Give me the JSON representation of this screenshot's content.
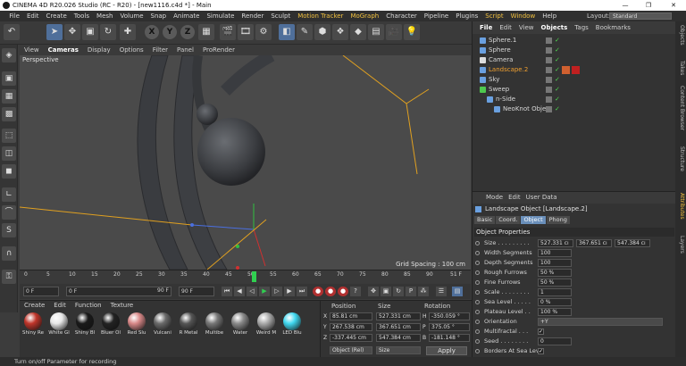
{
  "window": {
    "title": "CINEMA 4D R20.026 Studio (RC - R20) - [new1116.c4d *] - Main",
    "minimize": "—",
    "maximize": "❐",
    "close": "✕"
  },
  "menubar": {
    "items": [
      "File",
      "Edit",
      "Create",
      "Tools",
      "Mesh",
      "Volume",
      "Snap",
      "Animate",
      "Simulate",
      "Render",
      "Sculpt",
      "Motion Tracker",
      "MoGraph",
      "Character",
      "Pipeline",
      "Plugins",
      "Script",
      "Window",
      "Help"
    ],
    "layout_label": "Layout:",
    "layout_value": "Standard"
  },
  "toolbar": {
    "x": "X",
    "y": "Y",
    "z": "Z"
  },
  "viewport": {
    "menu": [
      "View",
      "Cameras",
      "Display",
      "Options",
      "Filter",
      "Panel",
      "ProRender"
    ],
    "label": "Perspective",
    "grid_spacing": "Grid Spacing : 100 cm"
  },
  "timeline": {
    "ticks": [
      "0",
      "5",
      "10",
      "15",
      "20",
      "25",
      "30",
      "35",
      "40",
      "45",
      "50",
      "55",
      "60",
      "65",
      "70",
      "75",
      "80",
      "85",
      "90"
    ],
    "end_label": "51 F",
    "current_frame": 51,
    "frame_field_1": "0 F",
    "frame_field_2": "0 F",
    "frame_field_3": "90 F",
    "frame_field_4": "90 F"
  },
  "materials": {
    "menu": [
      "Create",
      "Edit",
      "Function",
      "Texture"
    ],
    "items": [
      {
        "label": "Shiny Re",
        "color": "#c0352a"
      },
      {
        "label": "White Gl",
        "color": "#e8e8e8"
      },
      {
        "label": "Shiny Bl",
        "color": "#1a1a1a"
      },
      {
        "label": "Bluer Ol",
        "color": "#222222"
      },
      {
        "label": "Red Slu",
        "color": "#d88888"
      },
      {
        "label": "Vulcani",
        "color": "#6a6a6a"
      },
      {
        "label": "R Metal",
        "color": "#555555"
      },
      {
        "label": "Multibe",
        "color": "#777777"
      },
      {
        "label": "Water",
        "color": "#8a8a8a"
      },
      {
        "label": "Weird M",
        "color": "#aaaaaa"
      },
      {
        "label": "LED Blu",
        "color": "#40d8f0"
      }
    ]
  },
  "coords": {
    "headers": [
      "Position",
      "Size",
      "Rotation"
    ],
    "rows": [
      {
        "axis": "X",
        "pos": "85.81 cm",
        "size": "527.331 cm",
        "rot_axis": "H",
        "rot": "-350.059 °"
      },
      {
        "axis": "Y",
        "pos": "267.538 cm",
        "size": "367.651 cm",
        "rot_axis": "P",
        "rot": "375.05 °"
      },
      {
        "axis": "Z",
        "pos": "-337.445 cm",
        "size": "547.384 cm",
        "rot_axis": "B",
        "rot": "-181.148 °"
      }
    ],
    "mode": "Object (Rel)",
    "size_mode": "Size",
    "apply": "Apply"
  },
  "objects": {
    "menu": [
      "File",
      "Edit",
      "View",
      "Objects",
      "Tags",
      "Bookmarks"
    ],
    "list": [
      {
        "name": "Sphere.1",
        "indent": 0,
        "icon": "#6aa0e0",
        "highlight": false
      },
      {
        "name": "Sphere",
        "indent": 0,
        "icon": "#6aa0e0",
        "highlight": false
      },
      {
        "name": "Camera",
        "indent": 0,
        "icon": "#dddddd",
        "highlight": false
      },
      {
        "name": "Landscape.2",
        "indent": 0,
        "icon": "#6aa0e0",
        "highlight": true
      },
      {
        "name": "Sky",
        "indent": 0,
        "icon": "#6aa0e0",
        "highlight": false
      },
      {
        "name": "Sweep",
        "indent": 0,
        "icon": "#4ec84e",
        "highlight": false
      },
      {
        "name": "n-Side",
        "indent": 1,
        "icon": "#6aa0e0",
        "highlight": false
      },
      {
        "name": "NeoKnot Object",
        "indent": 2,
        "icon": "#6aa0e0",
        "highlight": false
      }
    ]
  },
  "sidetabs": [
    "Objects",
    "Takes",
    "Content Browser",
    "Structure",
    "Attributes",
    "Layers"
  ],
  "attributes": {
    "menu": [
      "Mode",
      "Edit",
      "User Data"
    ],
    "title": "Landscape Object [Landscape.2]",
    "tabs": [
      "Basic",
      "Coord.",
      "Object",
      "Phong"
    ],
    "section": "Object Properties",
    "props": [
      {
        "label": "Size . . . . . . . . .",
        "value": "527.331 cı",
        "value2": "367.651 cı",
        "value3": "547.384 cı"
      },
      {
        "label": "Width Segments",
        "value": "100"
      },
      {
        "label": "Depth Segments",
        "value": "100"
      },
      {
        "label": "Rough Furrows",
        "value": "50 %"
      },
      {
        "label": "Fine Furrows",
        "value": "50 %"
      },
      {
        "label": "Scale . . . . . . . .",
        "value": "1"
      },
      {
        "label": "Sea Level . . . . .",
        "value": "0 %"
      },
      {
        "label": "Plateau Level . .",
        "value": "100 %"
      },
      {
        "label": "Orientation",
        "value": "+Y"
      },
      {
        "label": "Multifractal . . .",
        "check": "✓"
      },
      {
        "label": "Seed . . . . . . . .",
        "value": "0"
      },
      {
        "label": "Borders At Sea Level",
        "check": "✓"
      },
      {
        "label": "Spherical . . . . .",
        "check": ""
      }
    ]
  },
  "status": {
    "text": "Turn on/off Parameter for recording"
  }
}
